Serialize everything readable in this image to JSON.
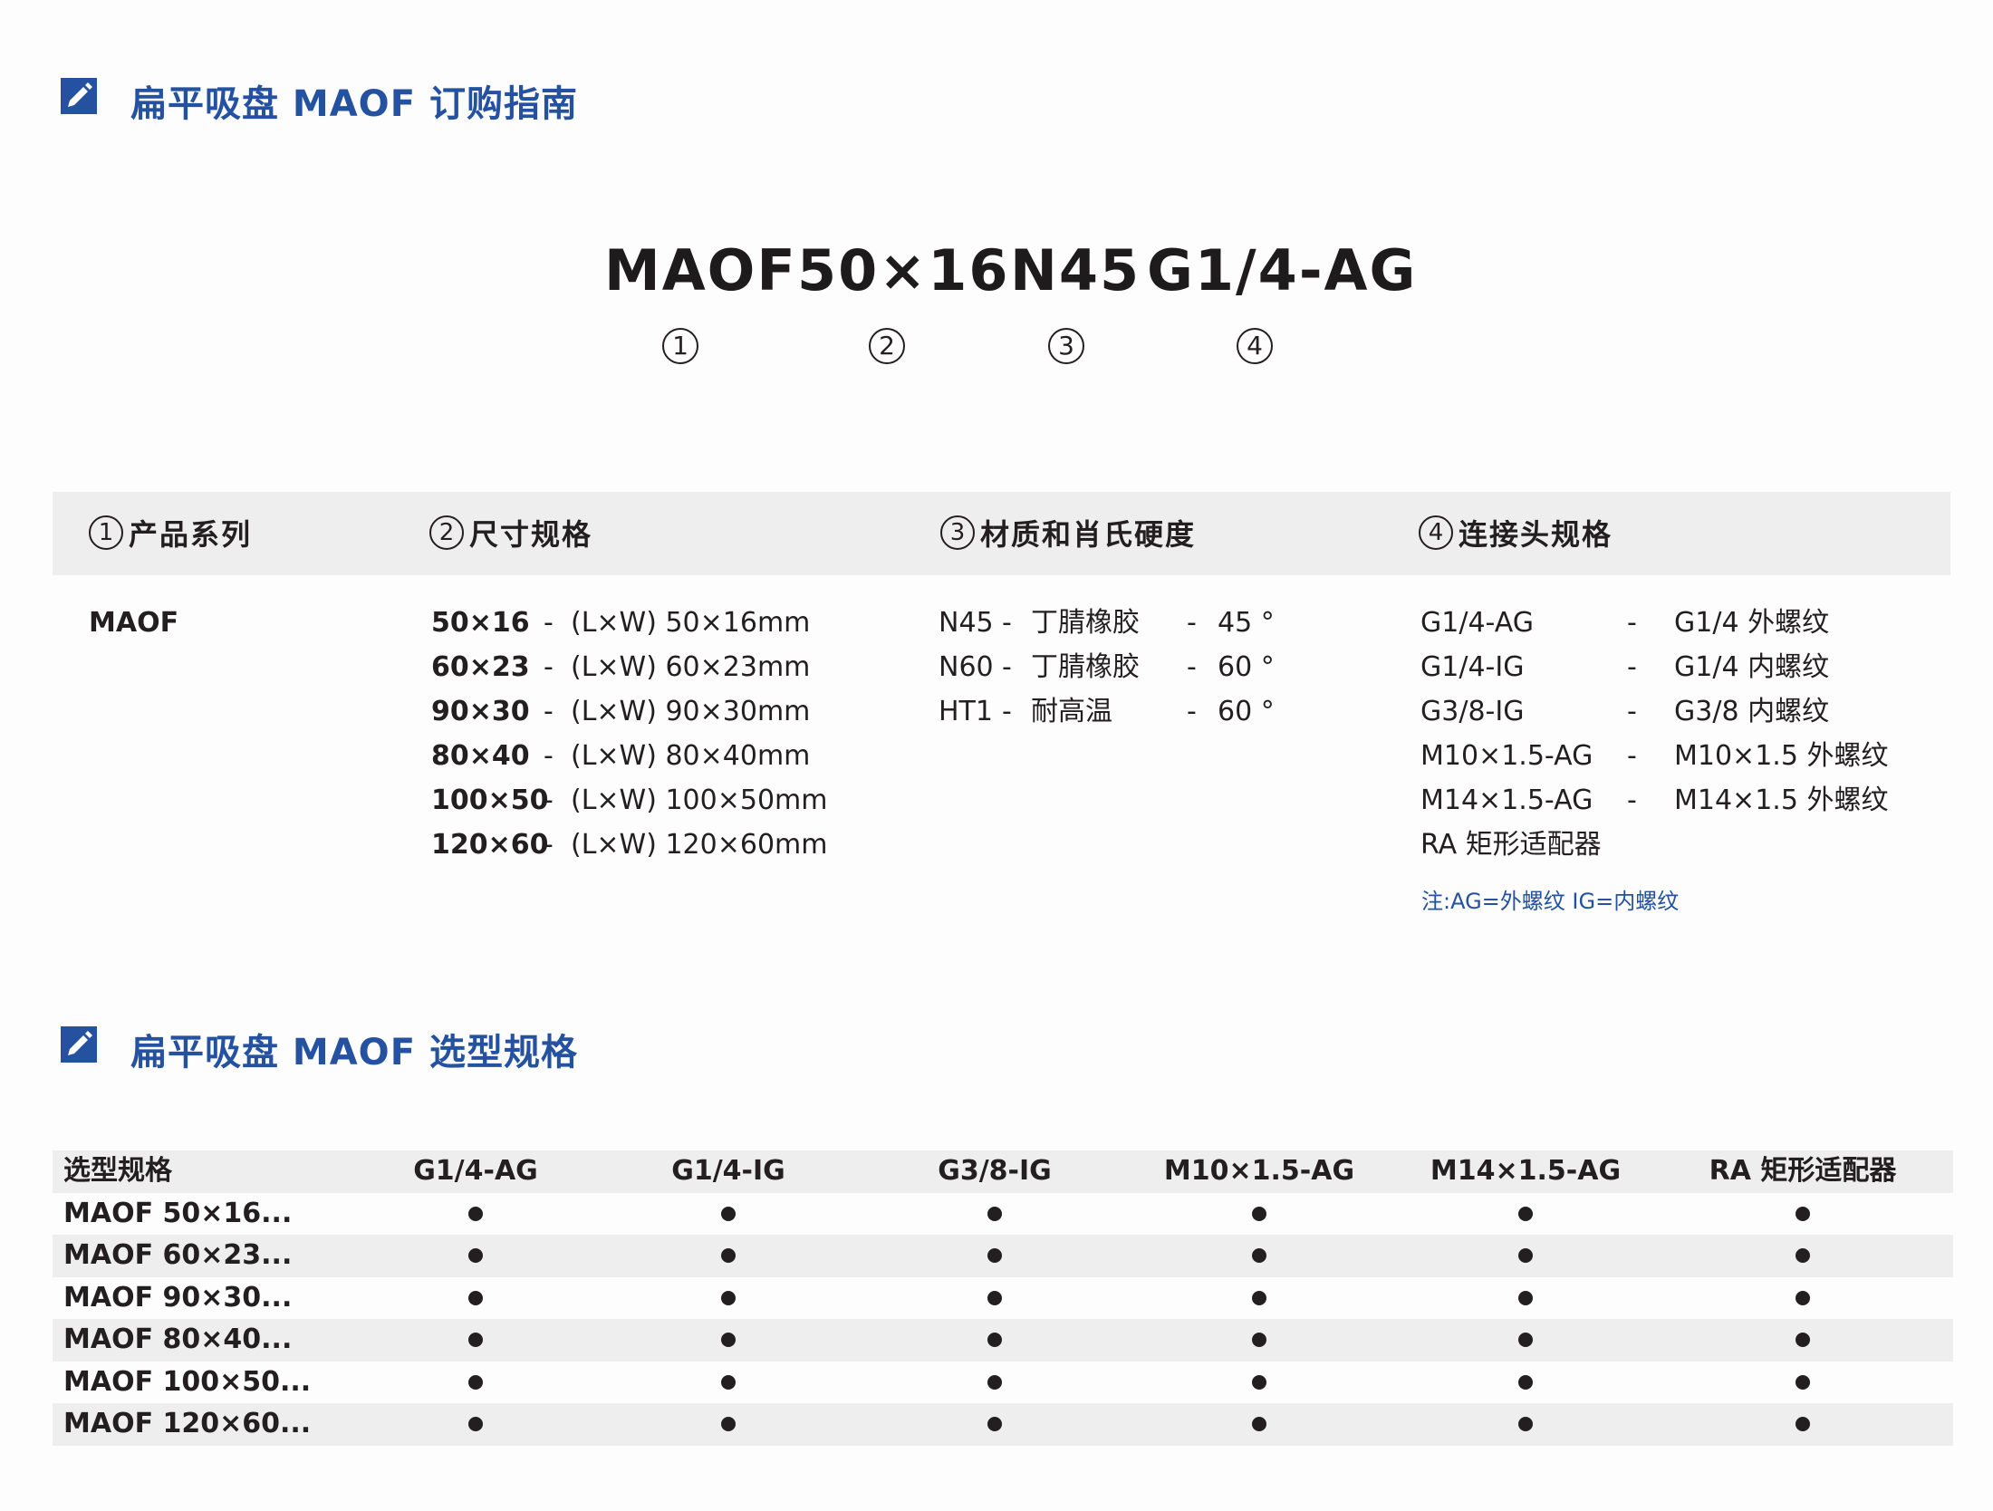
{
  "sections": {
    "guide_title": "扁平吸盘 MAOF 订购指南",
    "selection_title": "扁平吸盘 MAOF 选型规格"
  },
  "model_code": {
    "parts": [
      "MAOF",
      "50×16",
      "N45",
      "G1/4-AG"
    ],
    "markers": [
      "1",
      "2",
      "3",
      "4"
    ]
  },
  "guide": {
    "headers": [
      {
        "num": "1",
        "label": "产品系列"
      },
      {
        "num": "2",
        "label": "尺寸规格"
      },
      {
        "num": "3",
        "label": "材质和肖氏硬度"
      },
      {
        "num": "4",
        "label": "连接头规格"
      }
    ],
    "series": "MAOF",
    "sizes": [
      {
        "code": "50×16",
        "sep": "-",
        "desc": "(L×W) 50×16mm"
      },
      {
        "code": "60×23",
        "sep": "-",
        "desc": "(L×W) 60×23mm"
      },
      {
        "code": "90×30",
        "sep": "-",
        "desc": "(L×W) 90×30mm"
      },
      {
        "code": "80×40",
        "sep": "-",
        "desc": "(L×W) 80×40mm"
      },
      {
        "code": "100×50",
        "sep": "-",
        "desc": "(L×W) 100×50mm"
      },
      {
        "code": "120×60",
        "sep": "-",
        "desc": "(L×W) 120×60mm"
      }
    ],
    "materials": [
      {
        "code": "N45",
        "sep": "-",
        "name": "丁腈橡胶",
        "sep2": "-",
        "hardness": "45 °"
      },
      {
        "code": "N60",
        "sep": "-",
        "name": "丁腈橡胶",
        "sep2": "-",
        "hardness": "60 °"
      },
      {
        "code": "HT1",
        "sep": "-",
        "name": "耐高温",
        "sep2": "-",
        "hardness": "60 °"
      }
    ],
    "connectors": [
      {
        "code": "G1/4-AG",
        "sep": "-",
        "desc": "G1/4 外螺纹"
      },
      {
        "code": "G1/4-IG",
        "sep": "-",
        "desc": "G1/4 内螺纹"
      },
      {
        "code": "G3/8-IG",
        "sep": "-",
        "desc": "G3/8 内螺纹"
      },
      {
        "code": "M10×1.5-AG",
        "sep": "-",
        "desc": "M10×1.5 外螺纹"
      },
      {
        "code": "M14×1.5-AG",
        "sep": "-",
        "desc": "M14×1.5 外螺纹"
      },
      {
        "code": "RA 矩形适配器",
        "sep": "",
        "desc": ""
      }
    ],
    "note": "注:AG=外螺纹    IG=内螺纹"
  },
  "selection": {
    "headers": [
      "选型规格",
      "G1/4-AG",
      "G1/4-IG",
      "G3/8-IG",
      "M10×1.5-AG",
      "M14×1.5-AG",
      "RA 矩形适配器"
    ],
    "rows": [
      {
        "label": "MAOF 50×16...",
        "marks": [
          true,
          true,
          true,
          true,
          true,
          true
        ]
      },
      {
        "label": "MAOF 60×23...",
        "marks": [
          true,
          true,
          true,
          true,
          true,
          true
        ]
      },
      {
        "label": "MAOF 90×30...",
        "marks": [
          true,
          true,
          true,
          true,
          true,
          true
        ]
      },
      {
        "label": "MAOF 80×40...",
        "marks": [
          true,
          true,
          true,
          true,
          true,
          true
        ]
      },
      {
        "label": "MAOF 100×50...",
        "marks": [
          true,
          true,
          true,
          true,
          true,
          true
        ]
      },
      {
        "label": "MAOF 120×60...",
        "marks": [
          true,
          true,
          true,
          true,
          true,
          true
        ]
      }
    ]
  }
}
